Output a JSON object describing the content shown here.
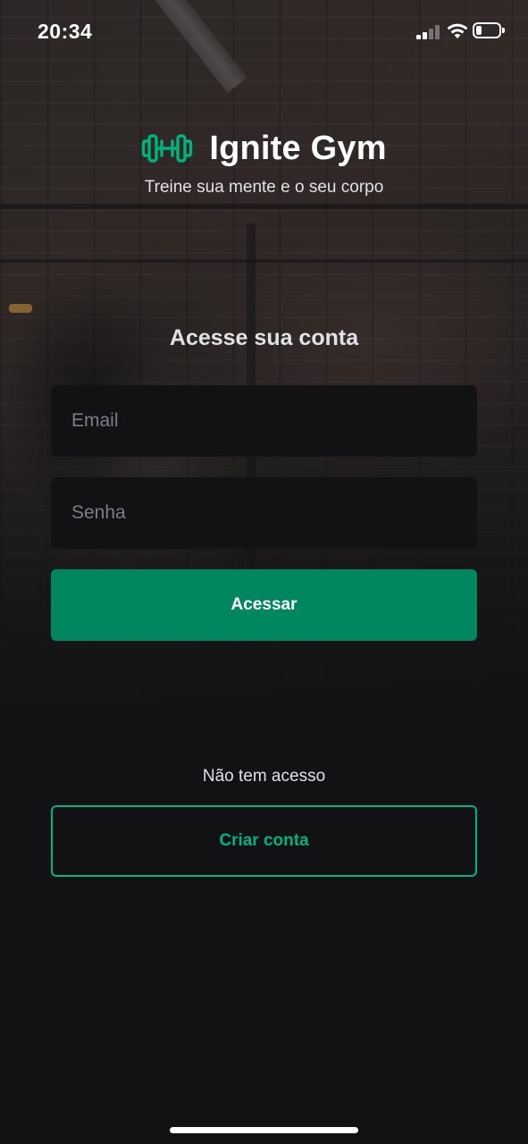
{
  "status_bar": {
    "time": "20:34",
    "signal_bars": 2,
    "signal_icon": "cellular-signal-icon",
    "wifi_icon": "wifi-icon",
    "battery_icon": "battery-icon",
    "battery_level": 0.25
  },
  "brand": {
    "logo_icon": "dumbbell-icon",
    "name": "Ignite Gym",
    "tagline": "Treine sua mente e o seu corpo"
  },
  "login": {
    "heading": "Acesse sua conta",
    "email_placeholder": "Email",
    "email_value": "",
    "password_placeholder": "Senha",
    "password_value": "",
    "submit_label": "Acessar"
  },
  "signup": {
    "prompt": "Não tem acesso",
    "button_label": "Criar conta"
  },
  "colors": {
    "background": "#121214",
    "input_background": "#121214",
    "primary": "#00875f",
    "accent": "#00b37e",
    "text": "#e1e1e6",
    "placeholder": "#7c7c8a"
  }
}
